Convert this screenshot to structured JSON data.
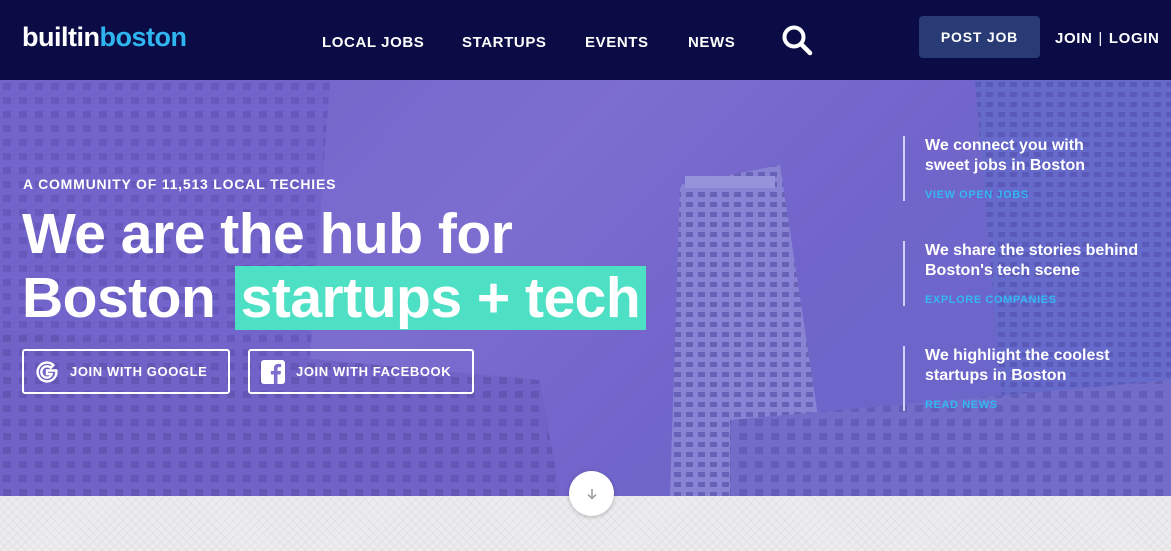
{
  "brand": {
    "part1": "built",
    "part2": "in",
    "part3": "boston",
    "accent": "#2fb5f0"
  },
  "nav": {
    "items": [
      "LOCAL JOBS",
      "STARTUPS",
      "EVENTS",
      "NEWS"
    ],
    "search_icon": "search-icon"
  },
  "header": {
    "post_job": "POST JOB",
    "join": "JOIN",
    "separator": "|",
    "login": "LOGIN",
    "bg": "#0b0b45",
    "button_bg": "#283b74"
  },
  "hero": {
    "kicker": "A COMMUNITY OF 11,513 LOCAL TECHIES",
    "line1": "We are the hub for",
    "line2": "Boston",
    "highlight": "startups + tech",
    "highlight_color": "#4ee0c4",
    "join_google": "JOIN WITH GOOGLE",
    "join_facebook": "JOIN WITH FACEBOOK"
  },
  "features": [
    {
      "title1": "We connect you with",
      "title2": "sweet jobs in Boston",
      "link": "VIEW OPEN JOBS"
    },
    {
      "title1": "We share the stories behind",
      "title2": "Boston's tech scene",
      "link": "EXPLORE COMPANIES"
    },
    {
      "title1": "We highlight the coolest",
      "title2": "startups in Boston",
      "link": "READ NEWS"
    }
  ],
  "link_color": "#34b8f3",
  "scroll_icon": "arrow-down-icon"
}
